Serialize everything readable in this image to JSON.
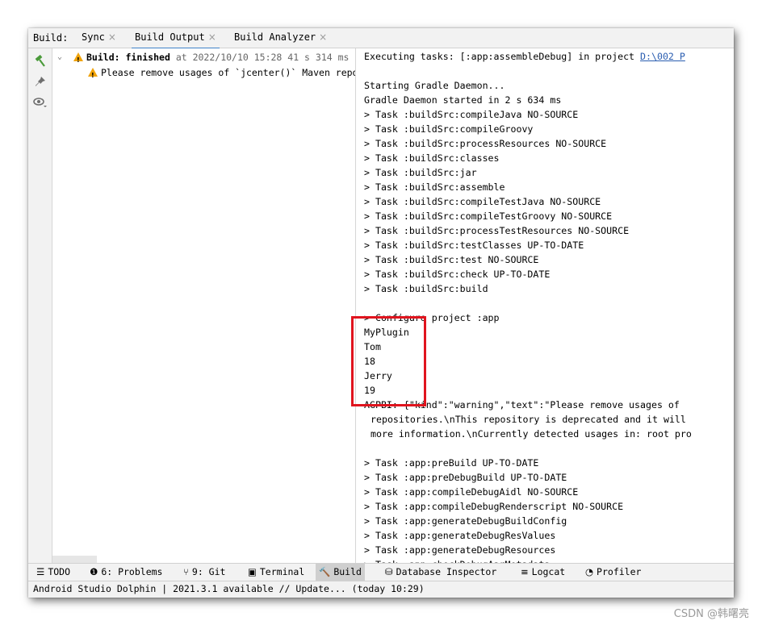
{
  "tabbar": {
    "label": "Build:",
    "tabs": [
      {
        "label": "Sync"
      },
      {
        "label": "Build Output"
      },
      {
        "label": "Build Analyzer"
      }
    ],
    "close_glyph": "×"
  },
  "toolbar": {
    "icons": [
      "hammer-icon",
      "pin-icon",
      "eye-icon"
    ]
  },
  "tree": {
    "root": {
      "title": "Build:",
      "status": "finished",
      "detail": "at 2022/10/10 15:28 41 s 314 ms"
    },
    "warning": "Please remove usages of `jcenter()` Maven repositories"
  },
  "console": {
    "lines": [
      {
        "text": "Executing tasks: [:app:assembleDebug] in project ",
        "link": "D:\\002 P"
      },
      {
        "text": ""
      },
      {
        "text": "Starting Gradle Daemon..."
      },
      {
        "text": "Gradle Daemon started in 2 s 634 ms"
      },
      {
        "text": "> Task :buildSrc:compileJava NO-SOURCE"
      },
      {
        "text": "> Task :buildSrc:compileGroovy"
      },
      {
        "text": "> Task :buildSrc:processResources NO-SOURCE"
      },
      {
        "text": "> Task :buildSrc:classes"
      },
      {
        "text": "> Task :buildSrc:jar"
      },
      {
        "text": "> Task :buildSrc:assemble"
      },
      {
        "text": "> Task :buildSrc:compileTestJava NO-SOURCE"
      },
      {
        "text": "> Task :buildSrc:compileTestGroovy NO-SOURCE"
      },
      {
        "text": "> Task :buildSrc:processTestResources NO-SOURCE"
      },
      {
        "text": "> Task :buildSrc:testClasses UP-TO-DATE"
      },
      {
        "text": "> Task :buildSrc:test NO-SOURCE"
      },
      {
        "text": "> Task :buildSrc:check UP-TO-DATE"
      },
      {
        "text": "> Task :buildSrc:build"
      },
      {
        "text": ""
      },
      {
        "text": "> Configure project :app"
      },
      {
        "text": "MyPlugin"
      },
      {
        "text": "Tom"
      },
      {
        "text": "18"
      },
      {
        "text": "Jerry"
      },
      {
        "text": "19"
      },
      {
        "text": "AGPBI: {\"kind\":\"warning\",\"text\":\"Please remove usages of"
      },
      {
        "text": "repositories.\\nThis repository is deprecated and it will",
        "indent": true
      },
      {
        "text": "more information.\\nCurrently detected usages in: root pro",
        "indent": true
      },
      {
        "text": ""
      },
      {
        "text": "> Task :app:preBuild UP-TO-DATE"
      },
      {
        "text": "> Task :app:preDebugBuild UP-TO-DATE"
      },
      {
        "text": "> Task :app:compileDebugAidl NO-SOURCE"
      },
      {
        "text": "> Task :app:compileDebugRenderscript NO-SOURCE"
      },
      {
        "text": "> Task :app:generateDebugBuildConfig"
      },
      {
        "text": "> Task :app:generateDebugResValues"
      },
      {
        "text": "> Task :app:generateDebugResources"
      },
      {
        "text": "> Task :app:checkDebugAarMetadata"
      }
    ]
  },
  "bottom_tools": [
    {
      "icon": "☰",
      "label": "TODO"
    },
    {
      "icon": "❶",
      "label": "6: Problems"
    },
    {
      "icon": "⑂",
      "label": "9: Git"
    },
    {
      "icon": "▣",
      "label": "Terminal"
    },
    {
      "icon": "🔨",
      "label": "Build",
      "active": true
    },
    {
      "icon": "⛁",
      "label": "Database Inspector"
    },
    {
      "icon": "≡",
      "label": "Logcat"
    },
    {
      "icon": "◔",
      "label": "Profiler"
    }
  ],
  "status": {
    "text": "Android Studio Dolphin | 2021.3.1 available // Update... (today 10:29)"
  },
  "watermark": "CSDN @韩曙亮",
  "colors": {
    "highlight": "#e0141e",
    "link": "#2a5db0",
    "warning": "#f0a30a",
    "hammer": "#4a9a3a"
  }
}
